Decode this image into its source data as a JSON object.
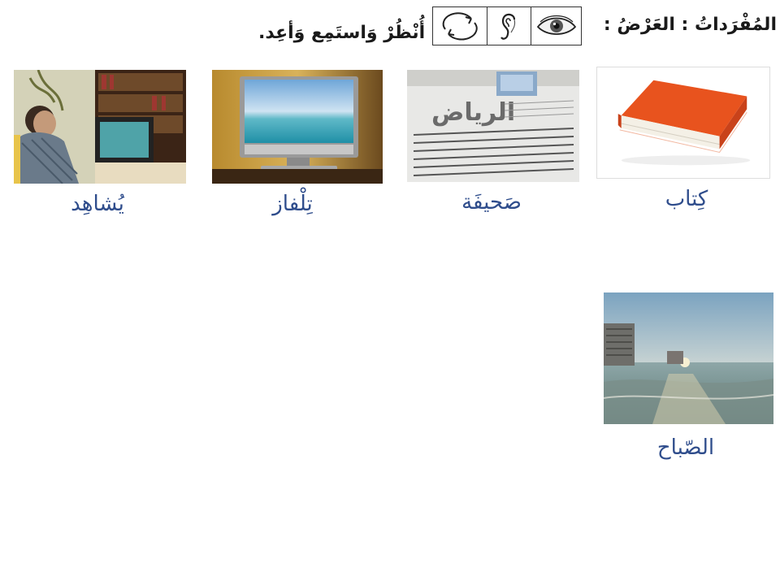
{
  "header": {
    "title": "المُفْرَداتُ : العَرْضُ :",
    "instruction": "أُنْظُرْ وَاستَمِع وَأعِد.",
    "icons": [
      "eye-icon",
      "ear-icon",
      "repeat-cycle-icon"
    ]
  },
  "vocabulary": [
    {
      "word": "كِتاب",
      "image": "book-image"
    },
    {
      "word": "صَحيفَة",
      "image": "newspaper-image"
    },
    {
      "word": "تِلْفاز",
      "image": "television-image"
    },
    {
      "word": "يُشاهِد",
      "image": "man-watching-tv-image"
    },
    {
      "word": "الصّباح",
      "image": "beach-morning-image"
    }
  ],
  "newspaper_masthead": "الرياض",
  "colors": {
    "word": "#2f4d8c",
    "book": "#e8531e",
    "text": "#1a1a1a"
  }
}
